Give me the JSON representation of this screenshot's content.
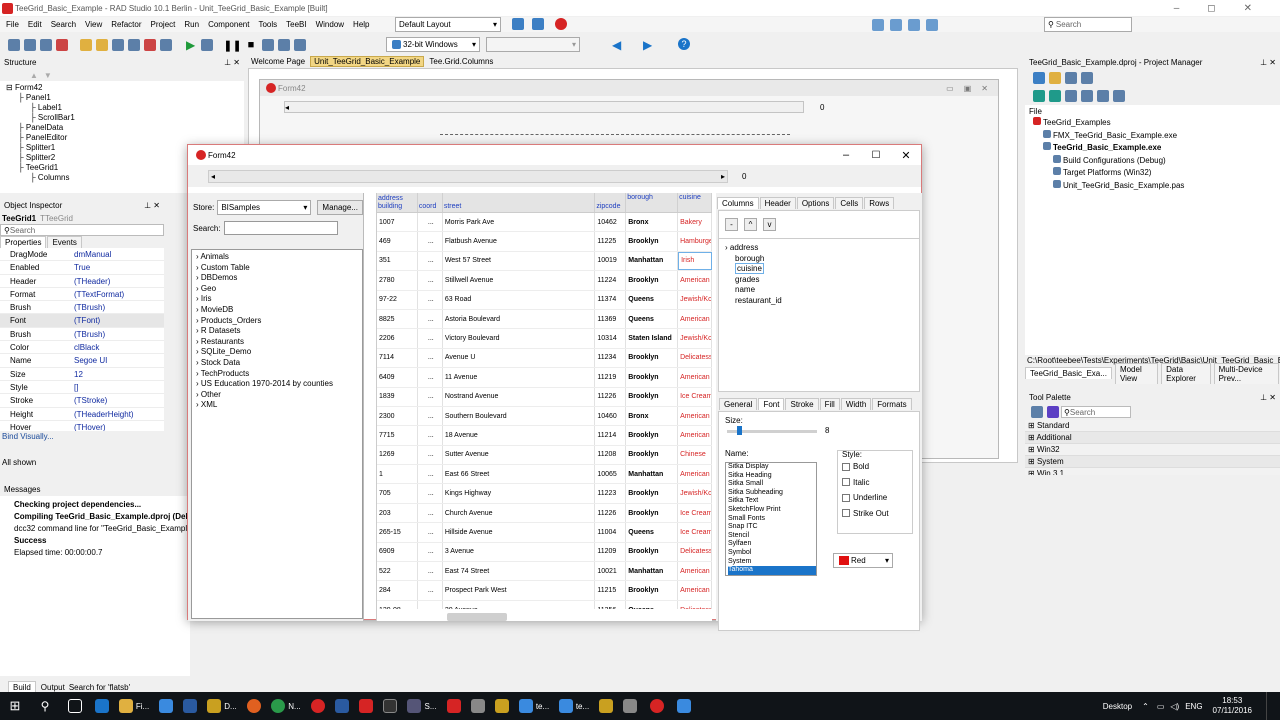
{
  "app": {
    "title": "TeeGrid_Basic_Example - RAD Studio 10.1 Berlin - Unit_TeeGrid_Basic_Example [Built]"
  },
  "menu": [
    "File",
    "Edit",
    "Search",
    "View",
    "Refactor",
    "Project",
    "Run",
    "Component",
    "Tools",
    "TeeBI",
    "Window",
    "Help"
  ],
  "toolbar": {
    "layout": "Default Layout",
    "platform": "32-bit Windows",
    "search_placeholder": "Search"
  },
  "structure": {
    "title": "Structure",
    "items": [
      "Form42",
      "Panel1",
      "Label1",
      "ScrollBar1",
      "PanelData",
      "PanelEditor",
      "Splitter1",
      "Splitter2",
      "TeeGrid1",
      "Columns"
    ]
  },
  "object_inspector": {
    "title": "Object Inspector",
    "selected": "TeeGrid1",
    "type": "TTeeGrid",
    "search": "Search",
    "tabs": [
      "Properties",
      "Events"
    ],
    "rows": [
      [
        "DragMode",
        "dmManual"
      ],
      [
        "Enabled",
        "True"
      ],
      [
        "Header",
        "(THeader)"
      ],
      [
        "Format",
        "(TTextFormat)"
      ],
      [
        "Brush",
        "(TBrush)"
      ],
      [
        "Font",
        "(TFont)"
      ],
      [
        "Brush",
        "(TBrush)"
      ],
      [
        "Color",
        "clBlack"
      ],
      [
        "Name",
        "Segoe UI"
      ],
      [
        "Size",
        "12"
      ],
      [
        "Style",
        "[]"
      ],
      [
        "Stroke",
        "(TStroke)"
      ],
      [
        "Height",
        "(THeaderHeight)"
      ],
      [
        "Hover",
        "(THover)"
      ]
    ],
    "bind": "Bind Visually...",
    "all": "All shown"
  },
  "messages": {
    "title": "Messages",
    "lines": [
      "Checking project dependencies...",
      "Compiling TeeGrid_Basic_Example.dproj (Debu",
      "dcc32 command line for \"TeeGrid_Basic_Example",
      "Success",
      "Elapsed time: 00:00:00.7"
    ]
  },
  "doc_tabs": [
    "Welcome Page",
    "Unit_TeeGrid_Basic_Example",
    "Tee.Grid.Columns"
  ],
  "designer": {
    "form_title": "Form42",
    "scroll_value": "0"
  },
  "form42": {
    "title": "Form42",
    "scroll_value": "0",
    "store_label": "Store:",
    "store_value": "BISamples",
    "manage": "Manage...",
    "search_label": "Search:",
    "datasets": [
      "Animals",
      "Custom Table",
      "DBDemos",
      "Geo",
      "Iris",
      "MovieDB",
      "Products_Orders",
      "R Datasets",
      "Restaurants",
      "SQLite_Demo",
      "Stock Data",
      "TechProducts",
      "US Education 1970-2014 by counties",
      "Other",
      "XML"
    ],
    "grid": {
      "header_group": "address",
      "headers": [
        "building",
        "coord",
        "street",
        "zipcode",
        "borough",
        "cuisine"
      ],
      "rows": [
        [
          "1007",
          "...",
          "Morris Park Ave",
          "10462",
          "Bronx",
          "Bakery"
        ],
        [
          "469",
          "...",
          "Flatbush Avenue",
          "11225",
          "Brooklyn",
          "Hamburge"
        ],
        [
          "351",
          "...",
          "West   57 Street",
          "10019",
          "Manhattan",
          "Irish"
        ],
        [
          "2780",
          "...",
          "Stillwell Avenue",
          "11224",
          "Brooklyn",
          "American"
        ],
        [
          "97-22",
          "...",
          "63 Road",
          "11374",
          "Queens",
          "Jewish/Ko"
        ],
        [
          "8825",
          "...",
          "Astoria Boulevard",
          "11369",
          "Queens",
          "American"
        ],
        [
          "2206",
          "...",
          "Victory Boulevard",
          "10314",
          "Staten Island",
          "Jewish/Ko"
        ],
        [
          "7114",
          "...",
          "Avenue U",
          "11234",
          "Brooklyn",
          "Delicatess"
        ],
        [
          "6409",
          "...",
          "11 Avenue",
          "11219",
          "Brooklyn",
          "American"
        ],
        [
          "1839",
          "...",
          "Nostrand Avenue",
          "11226",
          "Brooklyn",
          "Ice Cream"
        ],
        [
          "2300",
          "...",
          "Southern Boulevard",
          "10460",
          "Bronx",
          "American"
        ],
        [
          "7715",
          "...",
          "18 Avenue",
          "11214",
          "Brooklyn",
          "American"
        ],
        [
          "1269",
          "...",
          "Sutter Avenue",
          "11208",
          "Brooklyn",
          "Chinese"
        ],
        [
          "1",
          "...",
          "East   66 Street",
          "10065",
          "Manhattan",
          "American"
        ],
        [
          "705",
          "...",
          "Kings Highway",
          "11223",
          "Brooklyn",
          "Jewish/Ko"
        ],
        [
          "203",
          "...",
          "Church Avenue",
          "11226",
          "Brooklyn",
          "Ice Cream"
        ],
        [
          "265-15",
          "...",
          "Hillside Avenue",
          "11004",
          "Queens",
          "Ice Cream"
        ],
        [
          "6909",
          "...",
          "3 Avenue",
          "11209",
          "Brooklyn",
          "Delicatess"
        ],
        [
          "522",
          "...",
          "East   74 Street",
          "10021",
          "Manhattan",
          "American"
        ],
        [
          "284",
          "...",
          "Prospect Park West",
          "11215",
          "Brooklyn",
          "American"
        ],
        [
          "129-08",
          "...",
          "20 Avenue",
          "11356",
          "Queens",
          "Delicatess"
        ]
      ]
    },
    "editor": {
      "tabs": [
        "Columns",
        "Header",
        "Options",
        "Cells",
        "Rows"
      ],
      "btns": [
        "-",
        "^",
        "v"
      ],
      "columns": [
        "address",
        "borough",
        "cuisine",
        "grades",
        "name",
        "restaurant_id"
      ],
      "subtabs": [
        "General",
        "Font",
        "Stroke",
        "Fill",
        "Width",
        "Formats"
      ],
      "size_label": "Size:",
      "size_value": "8",
      "name_label": "Name:",
      "fonts": [
        "Sitka Display",
        "Sitka Heading",
        "Sitka Small",
        "Sitka Subheading",
        "Sitka Text",
        "SketchFlow Print",
        "Small Fonts",
        "Snap ITC",
        "Stencil",
        "Sylfaen",
        "Symbol",
        "System",
        "Tahoma"
      ],
      "style_label": "Style:",
      "styles": [
        "Bold",
        "Italic",
        "Underline",
        "Strike Out"
      ],
      "color": "Red"
    }
  },
  "project_manager": {
    "title": "TeeGrid_Basic_Example.dproj - Project Manager",
    "file_label": "File",
    "items": [
      "TeeGrid_Examples",
      "FMX_TeeGrid_Basic_Example.exe",
      "TeeGrid_Basic_Example.exe",
      "Build Configurations (Debug)",
      "Target Platforms (Win32)",
      "Unit_TeeGrid_Basic_Example.pas"
    ],
    "path": "C:\\Root\\teebee\\Tests\\Experiments\\TeeGrid\\Basic\\Unit_TeeGrid_Basic_Exa",
    "tabs": [
      "TeeGrid_Basic_Exa...",
      "Model View",
      "Data Explorer",
      "Multi-Device Prev..."
    ]
  },
  "palette": {
    "title": "Tool Palette",
    "search": "Search",
    "cats": [
      "Standard",
      "Additional",
      "Win32",
      "System",
      "Win 3.1"
    ]
  },
  "bottom_tabs": [
    "Build",
    "Output",
    "Search for 'flatsb'"
  ],
  "taskbar": {
    "labels": [
      "Fi...",
      "D...",
      "N...",
      "S...",
      "te...",
      "te..."
    ],
    "desktop": "Desktop",
    "lang": "ENG",
    "time": "18:53",
    "date": "07/11/2016"
  },
  "colors": {
    "accent": "#1a74c9",
    "red": "#d62424",
    "blue_text": "#102aa0"
  }
}
